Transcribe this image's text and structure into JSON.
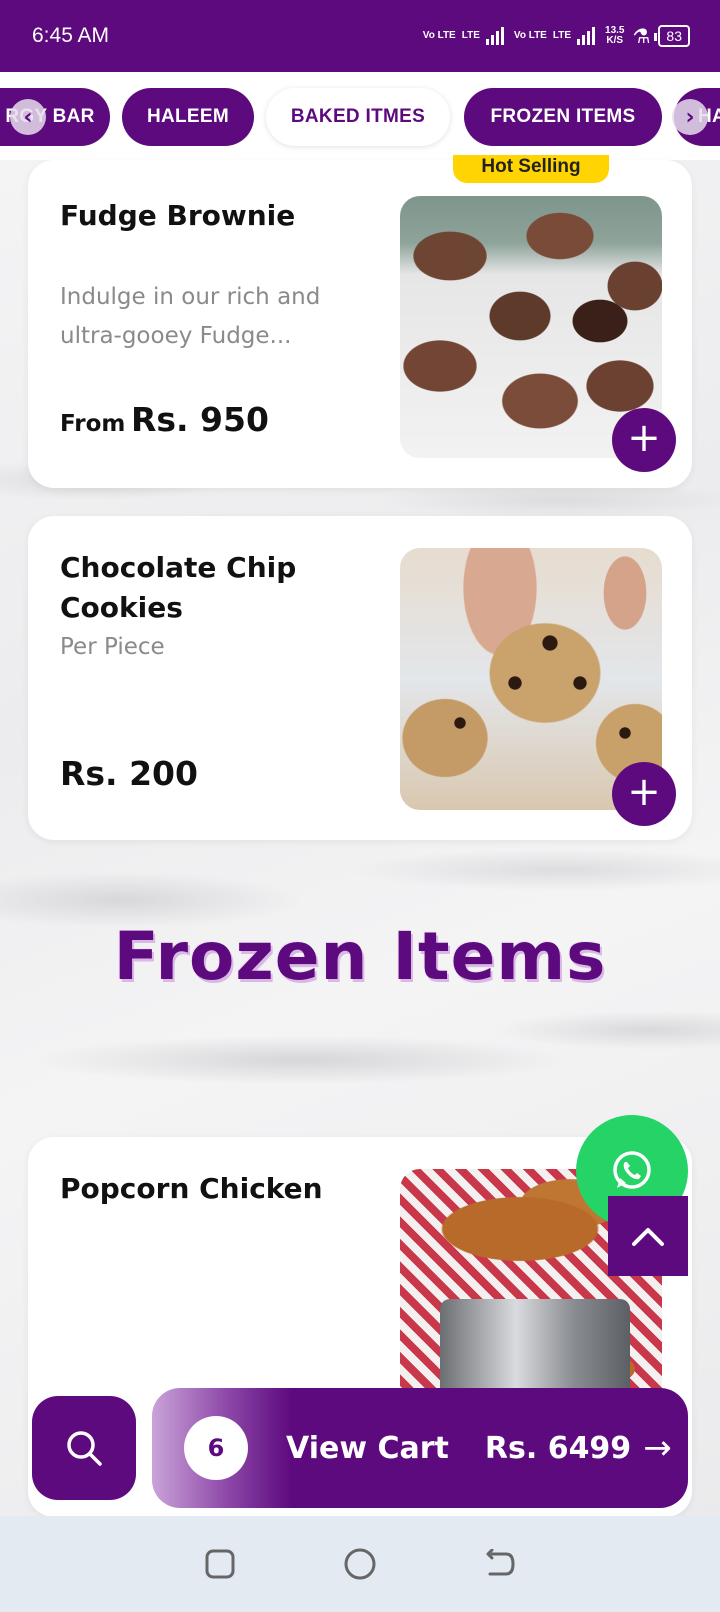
{
  "status_bar": {
    "time": "6:45 AM",
    "net1": "Vo LTE",
    "lte1": "LTE",
    "net2": "Vo LTE",
    "lte2": "LTE",
    "speed": "13.5",
    "speed_unit": "K/S",
    "battery": "83"
  },
  "tabs": {
    "partial_left": "RGY BAR",
    "haleem": "HALEEM",
    "baked": "BAKED ITMES",
    "frozen": "FROZEN ITEMS",
    "partial_right": "HA"
  },
  "products": {
    "brownie": {
      "badge": "Hot Selling",
      "title": "Fudge Brownie",
      "desc": "Indulge in our rich and ultra-gooey Fudge...",
      "price_prefix": "From",
      "price": "Rs. 950"
    },
    "cookies": {
      "title": "Chocolate Chip Cookies",
      "desc": "Per Piece",
      "price": "Rs. 200"
    },
    "popcorn": {
      "title": "Popcorn Chicken"
    }
  },
  "section": {
    "frozen_title": "Frozen Items"
  },
  "cart": {
    "count": "6",
    "label": "View Cart",
    "total": "Rs. 6499",
    "arrow": "→"
  },
  "icons": {
    "add": "+",
    "whatsapp": "whatsapp-icon",
    "scroll_top": "chevron-up-icon",
    "search": "search-icon"
  },
  "colors": {
    "brand": "#5d0a7e",
    "badge": "#ffd400",
    "whatsapp": "#25d366"
  }
}
